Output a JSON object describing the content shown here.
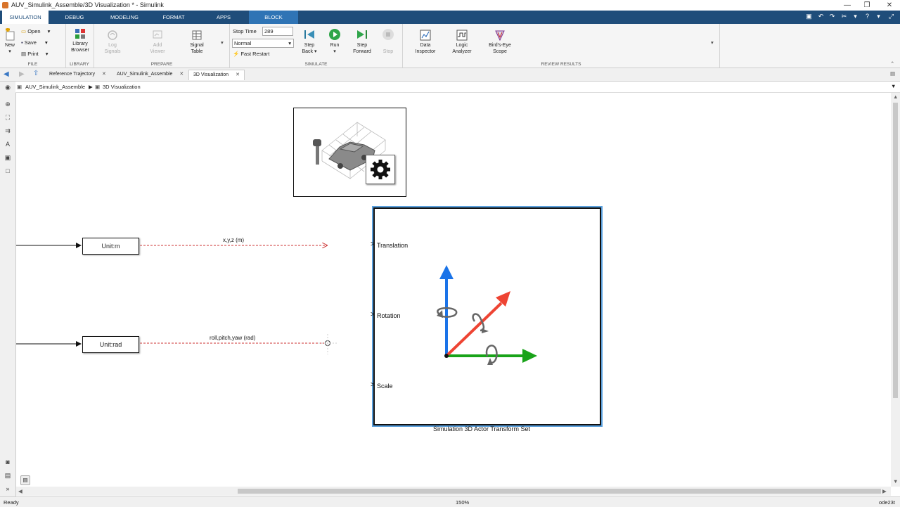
{
  "window": {
    "title": "AUV_Simulink_Assemble/3D Visualization * - Simulink",
    "minimize": "—",
    "restore": "❐",
    "close": "✕"
  },
  "ribbon_tabs": [
    "SIMULATION",
    "DEBUG",
    "MODELING",
    "FORMAT",
    "APPS",
    "BLOCK"
  ],
  "ribbon": {
    "file": {
      "section": "FILE",
      "new": "New",
      "open": "Open",
      "save": "Save",
      "print": "Print"
    },
    "library": {
      "section": "LIBRARY",
      "library_browser_1": "Library",
      "library_browser_2": "Browser"
    },
    "prepare": {
      "section": "PREPARE",
      "log_signals_1": "Log",
      "log_signals_2": "Signals",
      "add_viewer_1": "Add",
      "add_viewer_2": "Viewer",
      "signal_table_1": "Signal",
      "signal_table_2": "Table"
    },
    "simulate": {
      "section": "SIMULATE",
      "stop_time_label": "Stop Time",
      "stop_time_value": "289",
      "mode": "Normal",
      "fast_restart": "Fast Restart",
      "step_back_1": "Step",
      "step_back_2": "Back",
      "run": "Run",
      "step_forward_1": "Step",
      "step_forward_2": "Forward",
      "stop": "Stop"
    },
    "review": {
      "section": "REVIEW RESULTS",
      "data_inspector_1": "Data",
      "data_inspector_2": "Inspector",
      "logic_analyzer_1": "Logic",
      "logic_analyzer_2": "Analyzer",
      "birds_eye_1": "Bird's-Eye",
      "birds_eye_2": "Scope"
    }
  },
  "doc_tabs": [
    "Reference Trajectory",
    "AUV_Simulink_Assemble",
    "3D Visualization"
  ],
  "breadcrumb": [
    "AUV_Simulink_Assemble",
    "3D Visualization"
  ],
  "diagram": {
    "block_unit_m": "Unit:m",
    "block_unit_rad": "Unit:rad",
    "signal_xyz": "x,y,z (m)",
    "signal_rpy": "roll,pitch,yaw (rad)",
    "port_translation": "Translation",
    "port_rotation": "Rotation",
    "port_scale": "Scale",
    "transform_block_name": "Simulation 3D Actor Transform Set"
  },
  "status": {
    "left": "Ready",
    "zoom": "150%",
    "solver": "ode23t"
  },
  "colors": {
    "tab_strip": "#1f4d7a",
    "block_tab": "#2f74b5",
    "axis_x": "#19a319",
    "axis_y": "#1a73e8",
    "axis_z": "#ee4433"
  }
}
